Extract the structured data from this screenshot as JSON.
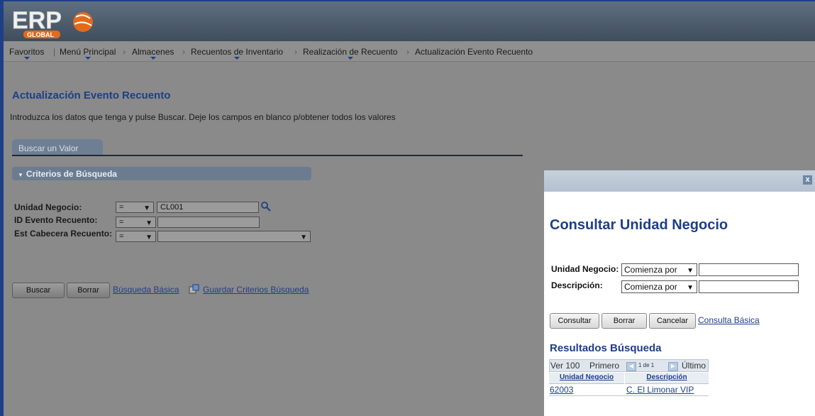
{
  "header": {
    "logo_text": "ERP",
    "logo_sub": "GLOBAL"
  },
  "nav": {
    "items": [
      "Favoritos",
      "Menú Principal",
      "Almacenes",
      "Recuentos de Inventario",
      "Realización de Recuento",
      "Actualización Evento Recuento"
    ],
    "separator": "›"
  },
  "page": {
    "title": "Actualización Evento Recuento",
    "intro": "Introduzca los datos que tenga y pulse Buscar. Deje los campos en blanco p/obtener todos los valores",
    "tab_label": "Buscar un Valor",
    "section_title": "Criterios de Búsqueda"
  },
  "criteria": {
    "unidad_negocio_label": "Unidad Negocio:",
    "unidad_negocio_op": "=",
    "unidad_negocio_value": "CL001",
    "id_evento_label": "ID Evento Recuento:",
    "id_evento_op": "=",
    "id_evento_value": "",
    "est_cabecera_label": "Est Cabecera Recuento:",
    "est_cabecera_op": "=",
    "est_cabecera_value": ""
  },
  "actions": {
    "buscar": "Buscar",
    "borrar": "Borrar",
    "busqueda_basica": "Búsqueda Básica",
    "guardar_criterios": "Guardar Criterios Búsqueda"
  },
  "modal": {
    "close": "x",
    "title": "Consultar Unidad Negocio",
    "unidad_label": "Unidad Negocio:",
    "unidad_op": "Comienza por",
    "descripcion_label": "Descripción:",
    "descripcion_op": "Comienza por",
    "consultar": "Consultar",
    "borrar": "Borrar",
    "cancelar": "Cancelar",
    "consulta_basica": "Consulta Básica",
    "results_title": "Resultados Búsqueda",
    "ver": "Ver 100",
    "primero": "Primero",
    "page_info": "1 de 1",
    "ultimo": "Último",
    "col_unidad": "Unidad Negocio",
    "col_descripcion": "Descripción",
    "row_unidad": "62003",
    "row_descripcion": "C. El Limonar VIP"
  },
  "colors": {
    "brand_blue": "#1d3f86",
    "overlay_gray": "#8a8a8a",
    "section_bar": "#6b7c90"
  }
}
